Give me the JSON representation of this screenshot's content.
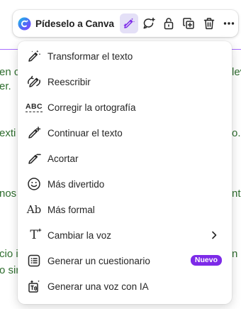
{
  "toolbar": {
    "ai_label": "Pídeselo a Canva",
    "buttons": [
      {
        "icon": "magic-pen-icon",
        "active": true
      },
      {
        "icon": "comment-add-icon"
      },
      {
        "icon": "lock-icon"
      },
      {
        "icon": "duplicate-icon"
      },
      {
        "icon": "trash-icon"
      },
      {
        "icon": "more-icon"
      }
    ]
  },
  "background_text": [
    "en c",
    "er.",
    "exti",
    "nos",
    "cio i",
    "o sir",
    "lev",
    "o.",
    "nte",
    "n"
  ],
  "menu": {
    "items": [
      {
        "label": "Transformar el texto",
        "icon": "magic-pen-sparkle-icon"
      },
      {
        "label": "Reescribir",
        "icon": "rewrite-pen-icon"
      },
      {
        "label": "Corregir la ortografía",
        "icon": "spellcheck-icon",
        "icon_text": "ABC"
      },
      {
        "label": "Continuar el texto",
        "icon": "continue-pen-icon"
      },
      {
        "label": "Acortar",
        "icon": "shorten-pen-icon"
      },
      {
        "label": "Más divertido",
        "icon": "smiley-icon"
      },
      {
        "label": "Más formal",
        "icon": "formal-text-icon",
        "icon_text": "Ab"
      },
      {
        "label": "Cambiar la voz",
        "icon": "voice-text-icon",
        "icon_text": "T",
        "has_submenu": true
      },
      {
        "label": "Generar un cuestionario",
        "icon": "quiz-list-icon",
        "badge": "Nuevo"
      },
      {
        "label": "Generar una voz con IA",
        "icon": "ai-voice-icon"
      }
    ]
  },
  "colors": {
    "accent": "#8b3dff",
    "badge": "#7d2ae8",
    "active_bg": "#e4e0f7",
    "background_text": "#2f6e2f"
  }
}
